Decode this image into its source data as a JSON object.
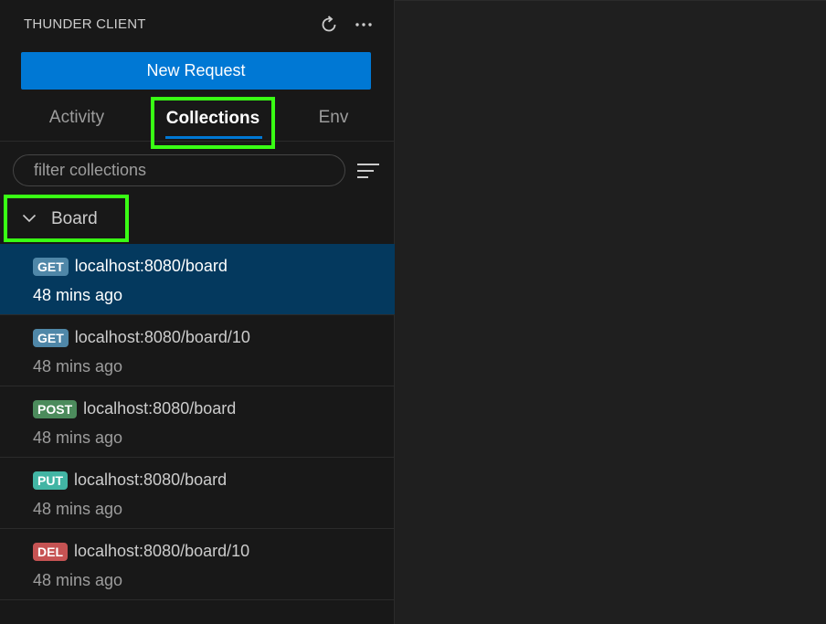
{
  "header": {
    "title": "THUNDER CLIENT",
    "refresh_icon": "refresh-icon",
    "more_icon": "ellipsis-icon"
  },
  "new_request": {
    "label": "New Request"
  },
  "tabs": [
    {
      "label": "Activity",
      "active": false
    },
    {
      "label": "Collections",
      "active": true
    },
    {
      "label": "Env",
      "active": false
    }
  ],
  "filter": {
    "placeholder": "filter collections",
    "value": ""
  },
  "collection": {
    "name": "Board",
    "expanded": true
  },
  "requests": [
    {
      "method": "GET",
      "url": "localhost:8080/board",
      "time": "48 mins ago",
      "selected": true
    },
    {
      "method": "GET",
      "url": "localhost:8080/board/10",
      "time": "48 mins ago",
      "selected": false
    },
    {
      "method": "POST",
      "url": "localhost:8080/board",
      "time": "48 mins ago",
      "selected": false
    },
    {
      "method": "PUT",
      "url": "localhost:8080/board",
      "time": "48 mins ago",
      "selected": false
    },
    {
      "method": "DEL",
      "url": "localhost:8080/board/10",
      "time": "48 mins ago",
      "selected": false
    }
  ],
  "colors": {
    "accent": "#0078d4",
    "highlight": "#39ff14",
    "selected_bg": "#04395e",
    "method_get": "#4f87a8",
    "method_post": "#4c8b5c",
    "method_put": "#42b5a4",
    "method_del": "#c65353"
  }
}
